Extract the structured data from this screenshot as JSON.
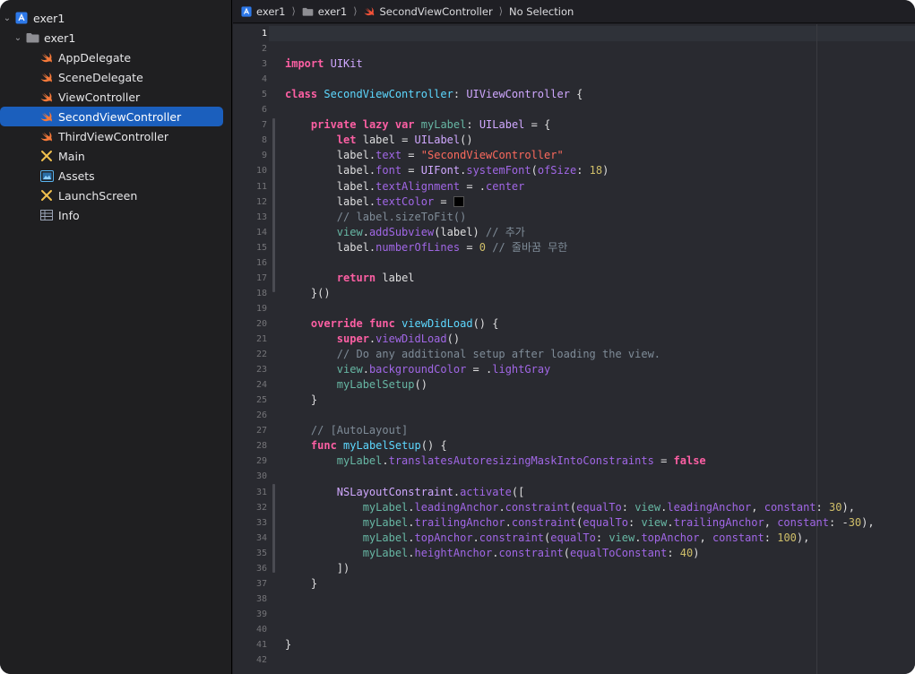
{
  "sidebar": {
    "project": "exer1",
    "group": "exer1",
    "files": [
      {
        "label": "AppDelegate",
        "icon": "swift-file-icon"
      },
      {
        "label": "SceneDelegate",
        "icon": "swift-file-icon"
      },
      {
        "label": "ViewController",
        "icon": "swift-file-icon"
      },
      {
        "label": "SecondViewController",
        "icon": "swift-file-icon",
        "selected": true
      },
      {
        "label": "ThirdViewController",
        "icon": "swift-file-icon"
      },
      {
        "label": "Main",
        "icon": "storyboard-icon"
      },
      {
        "label": "Assets",
        "icon": "asset-catalog-icon"
      },
      {
        "label": "LaunchScreen",
        "icon": "storyboard-icon"
      },
      {
        "label": "Info",
        "icon": "plist-icon"
      }
    ]
  },
  "jumpbar": {
    "project": "exer1",
    "folder": "exer1",
    "file": "SecondViewController",
    "selection": "No Selection"
  },
  "editor": {
    "active_line": 1,
    "line_count": 42,
    "lines": [
      "",
      "",
      "import UIKit",
      "",
      "class SecondViewController: UIViewController {",
      "",
      "    private lazy var myLabel: UILabel = {",
      "        let label = UILabel()",
      "        label.text = \"SecondViewController\"",
      "        label.font = UIFont.systemFont(ofSize: 18)",
      "        label.textAlignment = .center",
      "        label.textColor = ",
      "        // label.sizeToFit()",
      "        view.addSubview(label) // 추가",
      "        label.numberOfLines = 0 // 줄바꿈 무한",
      "",
      "        return label",
      "    }()",
      "",
      "    override func viewDidLoad() {",
      "        super.viewDidLoad()",
      "        // Do any additional setup after loading the view.",
      "        view.backgroundColor = .lightGray",
      "        myLabelSetup()",
      "    }",
      "",
      "    // [AutoLayout]",
      "    func myLabelSetup() {",
      "        myLabel.translatesAutoresizingMaskIntoConstraints = false",
      "",
      "        NSLayoutConstraint.activate([",
      "            myLabel.leadingAnchor.constraint(equalTo: view.leadingAnchor, constant: 30),",
      "            myLabel.trailingAnchor.constraint(equalTo: view.trailingAnchor, constant: -30),",
      "            myLabel.topAnchor.constraint(equalTo: view.topAnchor, constant: 100),",
      "            myLabel.heightAnchor.constraint(equalToConstant: 40)",
      "        ])",
      "    }",
      "",
      "",
      "",
      "}",
      ""
    ]
  },
  "colors": {
    "selection": "#1b5fbd",
    "editor_bg": "#292a30",
    "keyword": "#fc5fa3",
    "string": "#fc6a5d",
    "number": "#d0bf69",
    "comment": "#7f8c98"
  }
}
